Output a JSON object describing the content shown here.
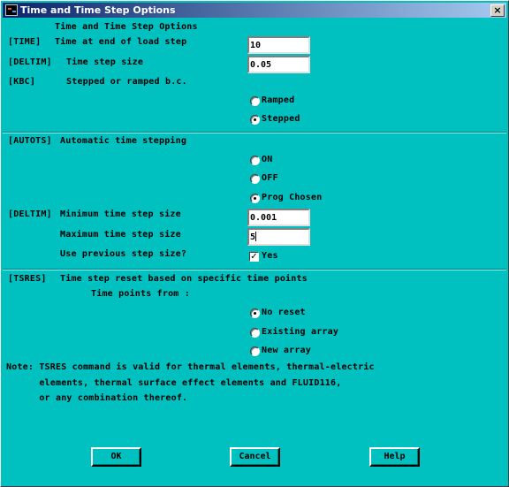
{
  "window": {
    "title": "Time and Time Step Options",
    "close_glyph": "×"
  },
  "section1": {
    "heading": "Time and Time Step Options",
    "time": {
      "tag": "[TIME]",
      "label": "Time at end of load step",
      "value": "10"
    },
    "deltim": {
      "tag": "[DELTIM]",
      "label": "Time step size",
      "value": "0.05"
    },
    "kbc": {
      "tag": "[KBC]",
      "label": "Stepped or ramped b.c.",
      "options": [
        {
          "label": "Ramped",
          "selected": false
        },
        {
          "label": "Stepped",
          "selected": true
        }
      ]
    }
  },
  "section2": {
    "autots": {
      "tag": "[AUTOTS]",
      "label": "Automatic time stepping",
      "options": [
        {
          "label": "ON",
          "selected": false
        },
        {
          "label": "OFF",
          "selected": false
        },
        {
          "label": "Prog Chosen",
          "selected": true
        }
      ]
    },
    "min_step": {
      "tag": "[DELTIM]",
      "label": "Minimum time step size",
      "value": "0.001"
    },
    "max_step": {
      "label": "Maximum time step size",
      "value": "5"
    },
    "use_prev": {
      "label": "Use previous step size?",
      "checkbox_label": "Yes",
      "checked": true
    }
  },
  "section3": {
    "tsres": {
      "tag": "[TSRES]",
      "label": "Time step reset based on specific time points"
    },
    "time_points_from": "Time points from :",
    "options": [
      {
        "label": "No reset",
        "selected": true
      },
      {
        "label": "Existing array",
        "selected": false
      },
      {
        "label": "New array",
        "selected": false
      }
    ],
    "note_lines": [
      "Note: TSRES command is valid for thermal elements, thermal-electric",
      "      elements, thermal surface effect elements and FLUID116,",
      "      or any combination thereof."
    ]
  },
  "buttons": {
    "ok": "OK",
    "cancel": "Cancel",
    "help": "Help"
  }
}
